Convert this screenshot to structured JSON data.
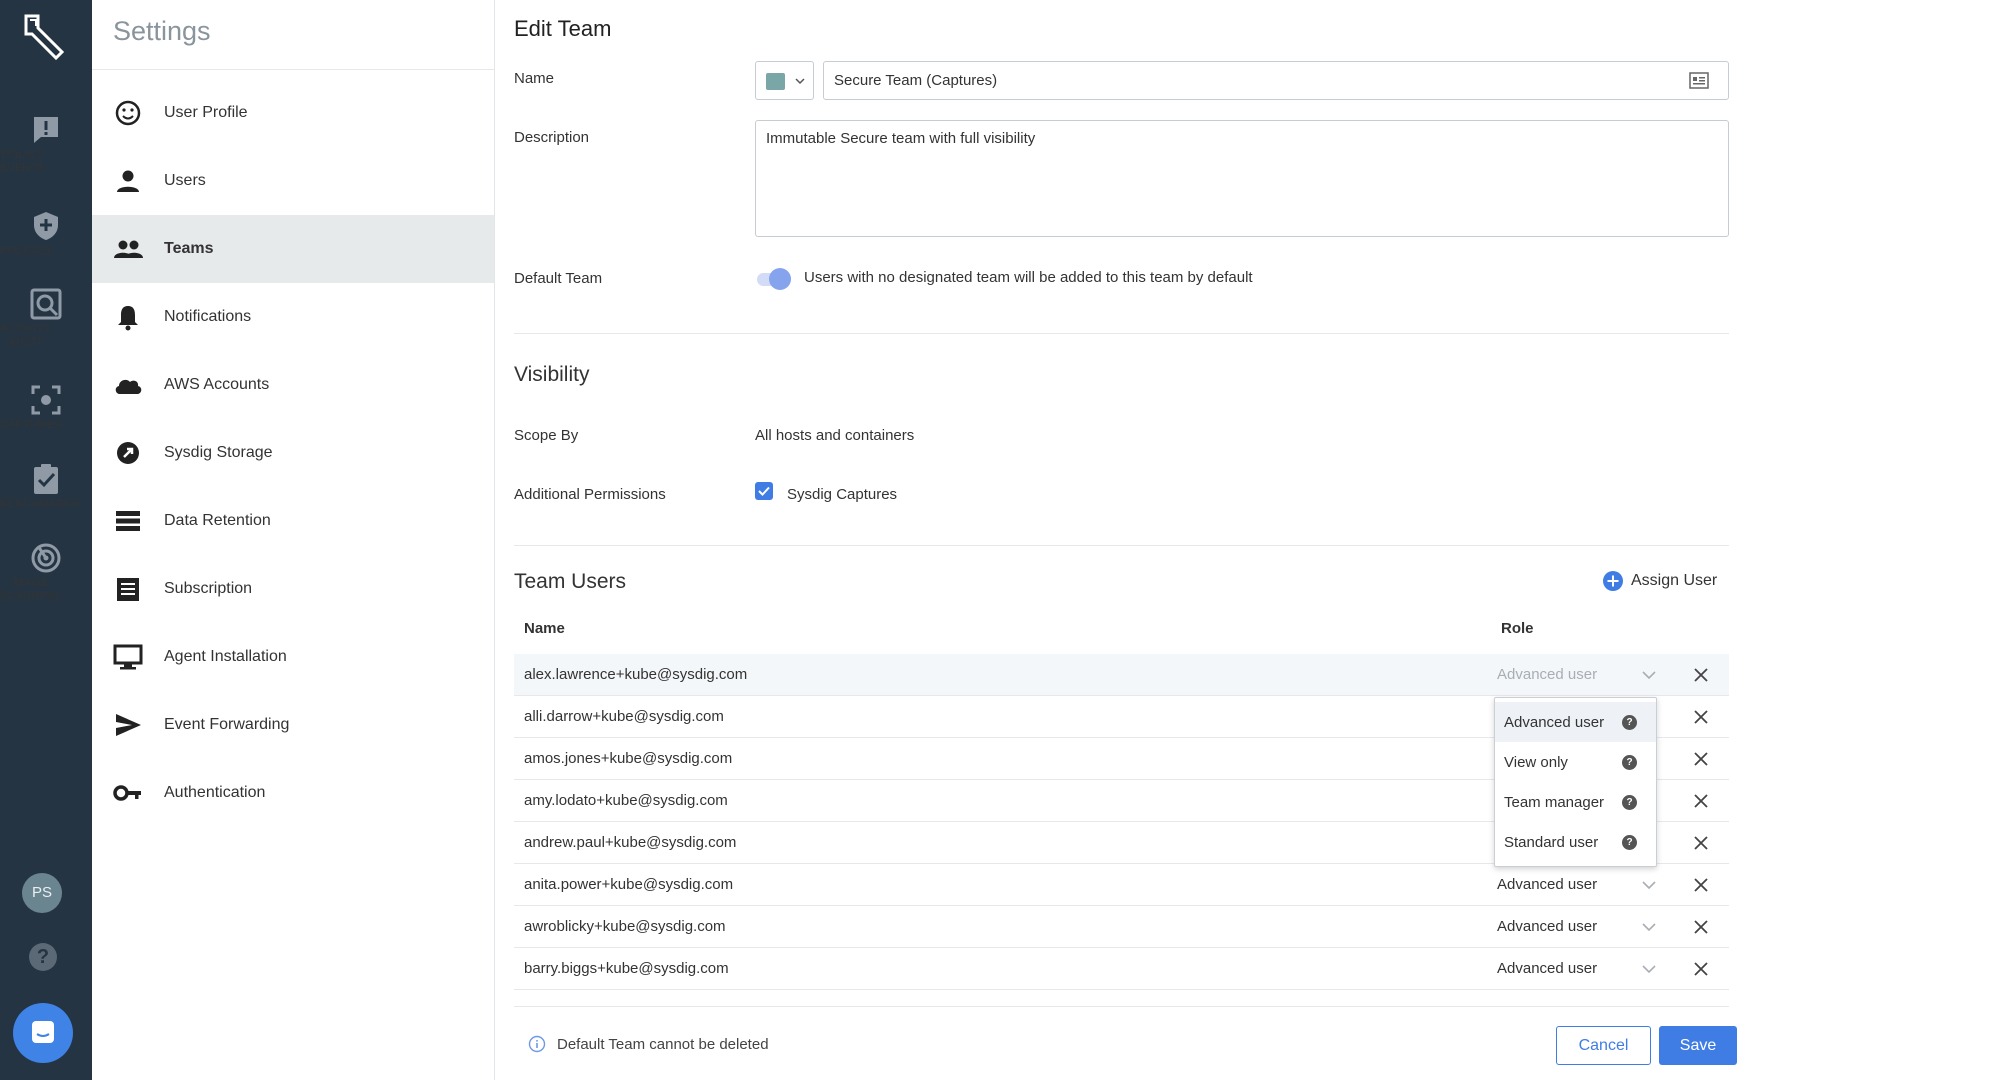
{
  "nav": {
    "items": [
      {
        "label": "POLICY\nEVENTS",
        "icon": "alert-message-icon"
      },
      {
        "label": "POLICIES",
        "icon": "shield-icon"
      },
      {
        "label": "ACTIVITY\nAUDIT",
        "icon": "search-audit-icon"
      },
      {
        "label": "CAPTURES",
        "icon": "capture-icon"
      },
      {
        "label": "BENCHMARKS",
        "icon": "checkmark-clipboard-icon"
      },
      {
        "label": "IMAGE\nSCANNING",
        "icon": "radar-icon"
      }
    ],
    "avatar_initials": "PS",
    "help_glyph": "?"
  },
  "sidebar": {
    "title": "Settings",
    "items": [
      {
        "label": "User Profile",
        "icon": "smiley-icon"
      },
      {
        "label": "Users",
        "icon": "person-icon"
      },
      {
        "label": "Teams",
        "icon": "people-icon"
      },
      {
        "label": "Notifications",
        "icon": "bell-icon"
      },
      {
        "label": "AWS Accounts",
        "icon": "cloud-icon"
      },
      {
        "label": "Sysdig Storage",
        "icon": "rocket-icon"
      },
      {
        "label": "Data Retention",
        "icon": "storage-icon"
      },
      {
        "label": "Subscription",
        "icon": "receipt-icon"
      },
      {
        "label": "Agent Installation",
        "icon": "monitor-icon"
      },
      {
        "label": "Event Forwarding",
        "icon": "send-icon"
      },
      {
        "label": "Authentication",
        "icon": "key-icon"
      }
    ],
    "active": "Teams"
  },
  "edit_team": {
    "heading": "Edit Team",
    "name_label": "Name",
    "name_value": "Secure Team (Captures)",
    "team_color": "#7ba6a8",
    "description_label": "Description",
    "description_value": "Immutable Secure team with full visibility",
    "default_team_label": "Default Team",
    "default_team_on": true,
    "default_team_text": "Users with no designated team will be added to this team by default"
  },
  "visibility": {
    "heading": "Visibility",
    "scope_label": "Scope By",
    "scope_value": "All hosts and containers",
    "permissions_label": "Additional Permissions",
    "permission_sysdig_captures": "Sysdig Captures",
    "permission_checked": true
  },
  "team_users": {
    "heading": "Team Users",
    "assign_label": "Assign User",
    "col_name": "Name",
    "col_role": "Role",
    "rows": [
      {
        "email": "alex.lawrence+kube@sysdig.com",
        "role": "Advanced user"
      },
      {
        "email": "alli.darrow+kube@sysdig.com",
        "role": ""
      },
      {
        "email": "amos.jones+kube@sysdig.com",
        "role": ""
      },
      {
        "email": "amy.lodato+kube@sysdig.com",
        "role": ""
      },
      {
        "email": "andrew.paul+kube@sysdig.com",
        "role": ""
      },
      {
        "email": "anita.power+kube@sysdig.com",
        "role": "Advanced user"
      },
      {
        "email": "awroblicky+kube@sysdig.com",
        "role": "Advanced user"
      },
      {
        "email": "barry.biggs+kube@sysdig.com",
        "role": "Advanced user"
      }
    ],
    "role_options": [
      "Advanced user",
      "View only",
      "Team manager",
      "Standard user"
    ],
    "help_glyph": "?"
  },
  "footer": {
    "info_text": "Default Team cannot be deleted",
    "cancel_label": "Cancel",
    "save_label": "Save"
  },
  "colors": {
    "rail_bg": "#253443",
    "accent": "#3f7de5",
    "active_row": "#e7eaeb"
  }
}
